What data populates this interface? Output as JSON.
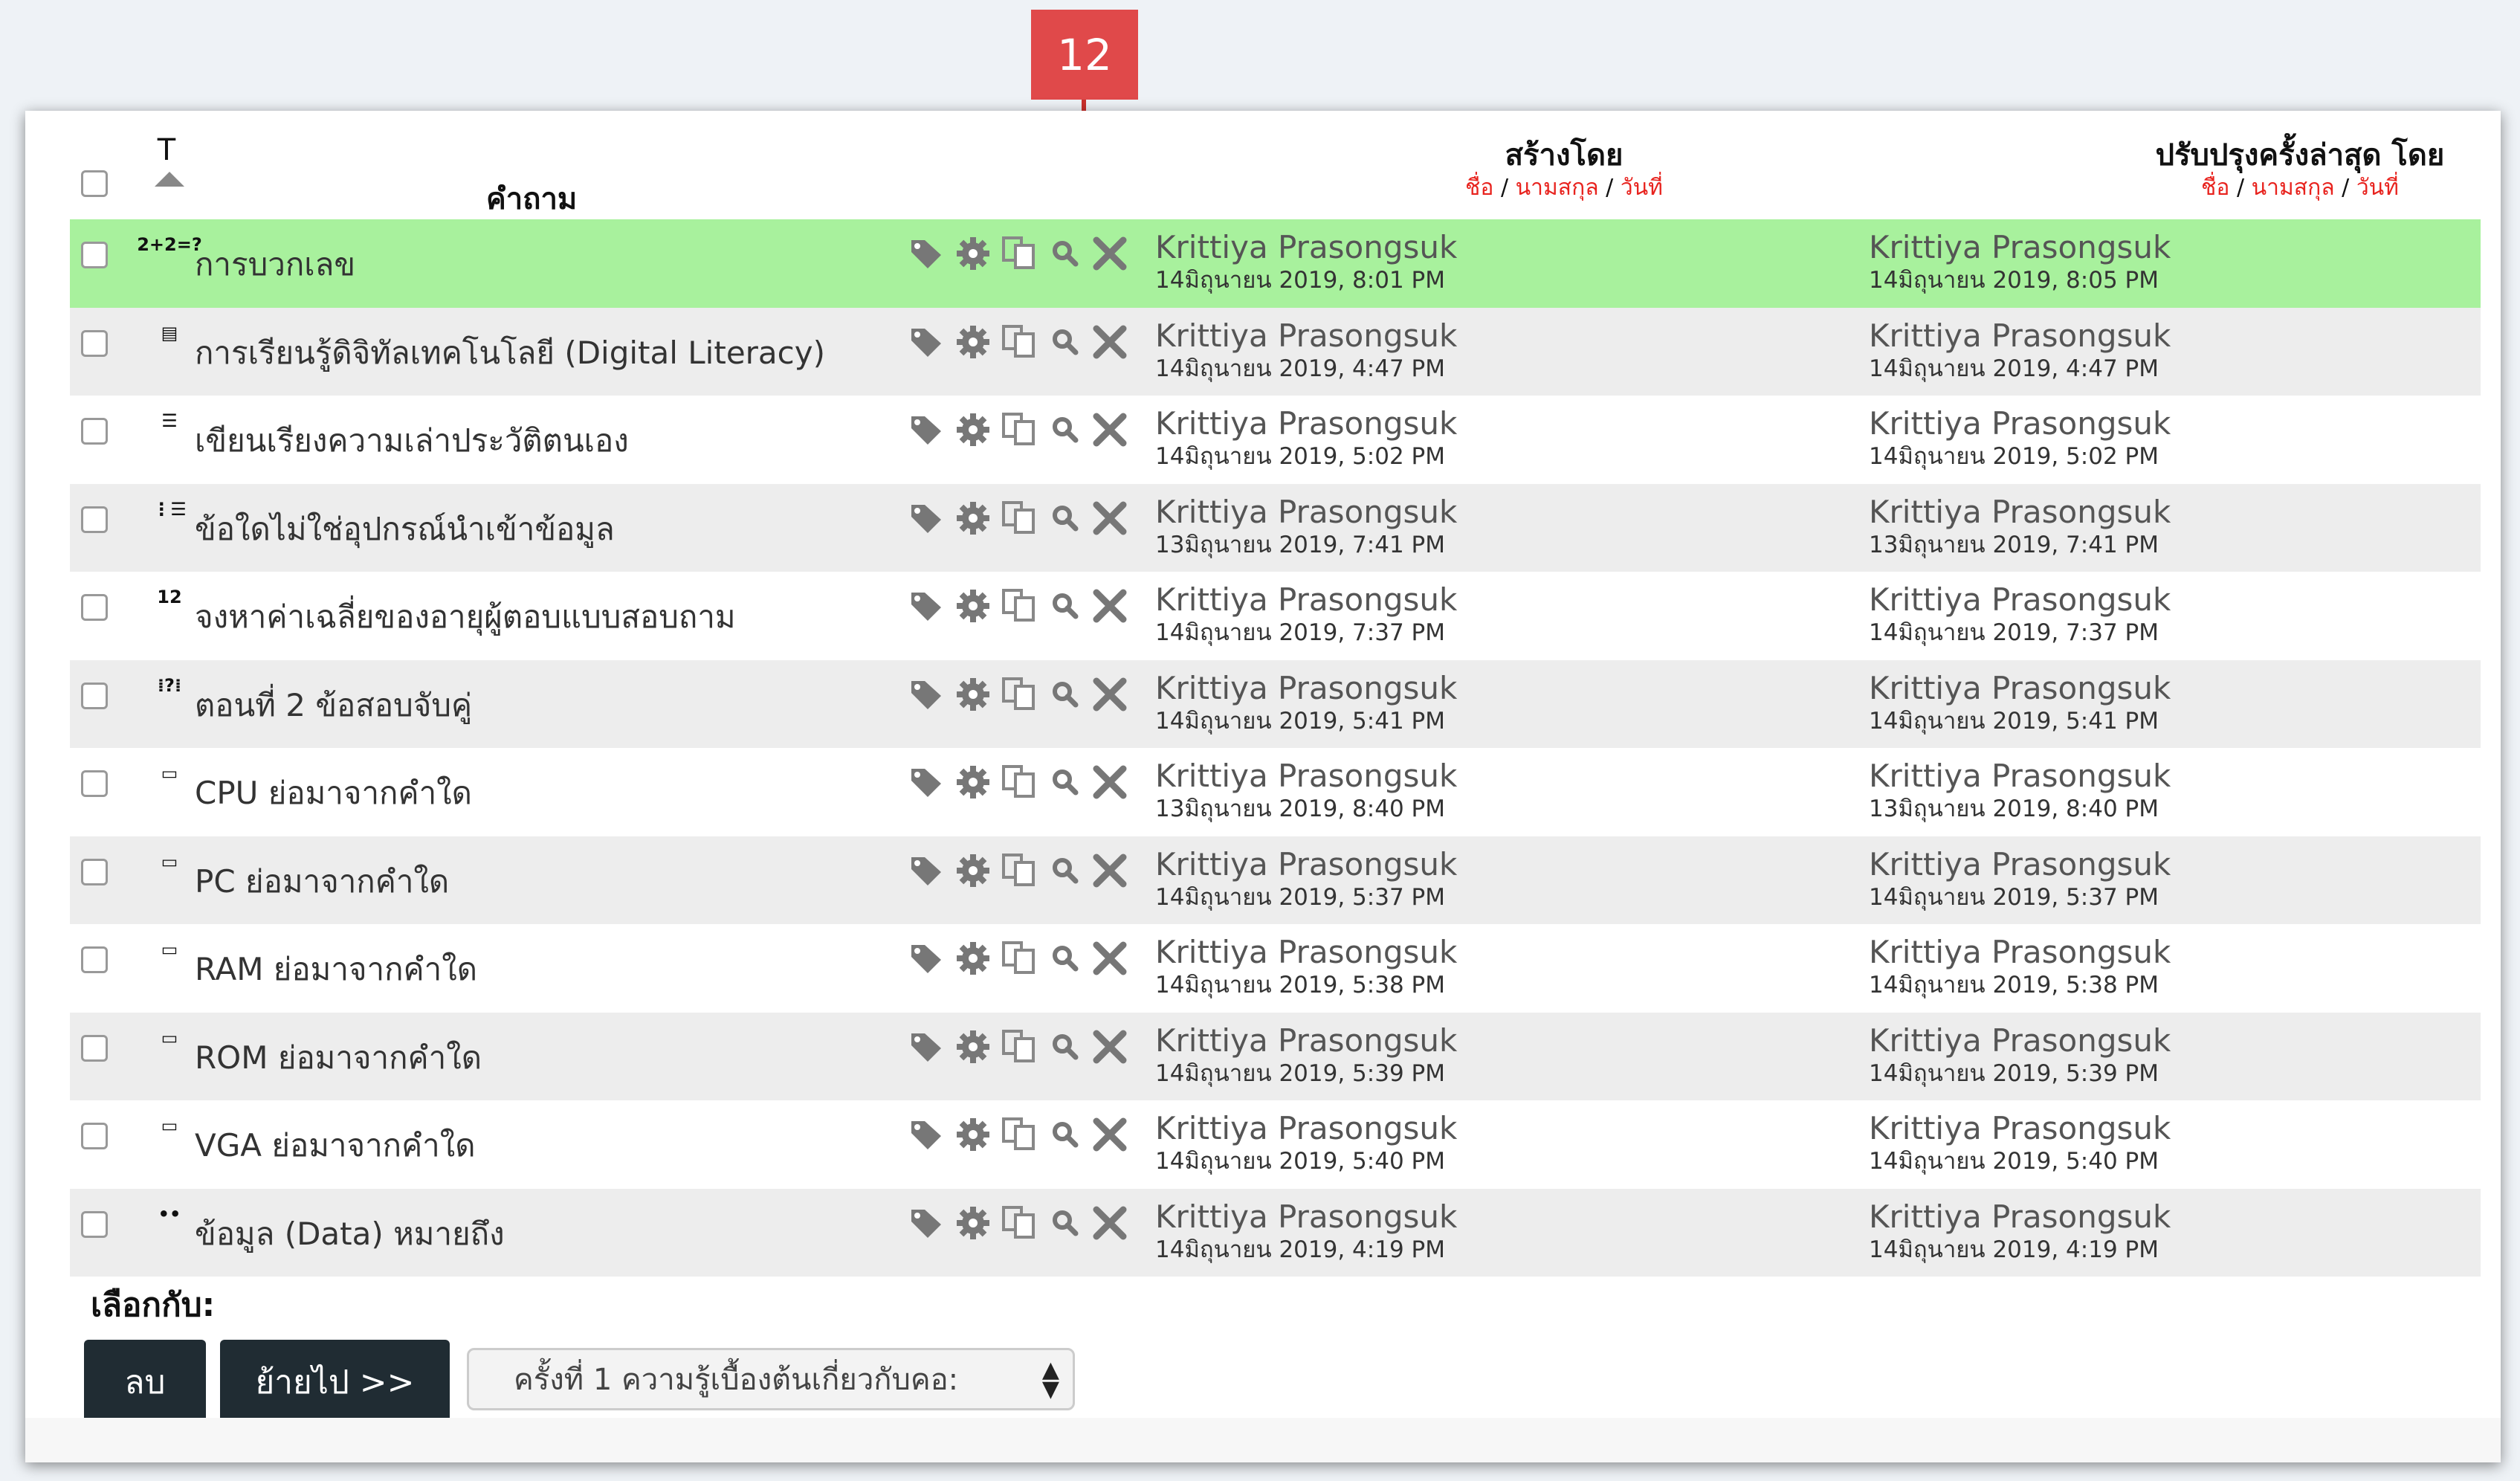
{
  "callout": {
    "number": "12"
  },
  "header": {
    "type_col": "T",
    "question_col": "คำถาม",
    "created_title": "สร้างโดย",
    "modified_title": "ปรับปรุงครั้งล่าสุด โดย",
    "sub_first": "ชื่อ",
    "sub_sep1": " / ",
    "sub_last": "นามสกุล",
    "sub_sep2": " / ",
    "sub_date": "วันที่"
  },
  "rows": [
    {
      "type_icon": "calculated-icon",
      "type_glyph": "2+2=?",
      "name": "การบวกเลข",
      "created_by": "Krittiya Prasongsuk",
      "created_date": "14มิถุนายน 2019, 8:01 PM",
      "modified_by": "Krittiya Prasongsuk",
      "modified_date": "14มิถุนายน 2019, 8:05 PM",
      "highlight": true
    },
    {
      "type_icon": "description-icon",
      "type_glyph": "▤",
      "name": "การเรียนรู้ดิจิทัลเทคโนโลยี (Digital Literacy)",
      "created_by": "Krittiya Prasongsuk",
      "created_date": "14มิถุนายน 2019, 4:47 PM",
      "modified_by": "Krittiya Prasongsuk",
      "modified_date": "14มิถุนายน 2019, 4:47 PM"
    },
    {
      "type_icon": "essay-icon",
      "type_glyph": "☰",
      "name": "เขียนเรียงความเล่าประวัติตนเอง",
      "created_by": "Krittiya Prasongsuk",
      "created_date": "14มิถุนายน 2019, 5:02 PM",
      "modified_by": "Krittiya Prasongsuk",
      "modified_date": "14มิถุนายน 2019, 5:02 PM"
    },
    {
      "type_icon": "multichoice-icon",
      "type_glyph": "⋮☰",
      "name": "ข้อใดไม่ใช่อุปกรณ์นำเข้าข้อมูล",
      "created_by": "Krittiya Prasongsuk",
      "created_date": "13มิถุนายน 2019, 7:41 PM",
      "modified_by": "Krittiya Prasongsuk",
      "modified_date": "13มิถุนายน 2019, 7:41 PM"
    },
    {
      "type_icon": "numerical-icon",
      "type_glyph": "12",
      "name": "จงหาค่าเฉลี่ยของอายุผู้ตอบแบบสอบถาม",
      "created_by": "Krittiya Prasongsuk",
      "created_date": "14มิถุนายน 2019, 7:37 PM",
      "modified_by": "Krittiya Prasongsuk",
      "modified_date": "14มิถุนายน 2019, 7:37 PM"
    },
    {
      "type_icon": "matching-icon",
      "type_glyph": "⁞?⁞",
      "name": "ตอนที่ 2 ข้อสอบจับคู่",
      "created_by": "Krittiya Prasongsuk",
      "created_date": "14มิถุนายน 2019, 5:41 PM",
      "modified_by": "Krittiya Prasongsuk",
      "modified_date": "14มิถุนายน 2019, 5:41 PM"
    },
    {
      "type_icon": "shortanswer-icon",
      "type_glyph": "▭",
      "name": "CPU ย่อมาจากคำใด",
      "created_by": "Krittiya Prasongsuk",
      "created_date": "13มิถุนายน 2019, 8:40 PM",
      "modified_by": "Krittiya Prasongsuk",
      "modified_date": "13มิถุนายน 2019, 8:40 PM"
    },
    {
      "type_icon": "shortanswer-icon",
      "type_glyph": "▭",
      "name": "PC ย่อมาจากคำใด",
      "created_by": "Krittiya Prasongsuk",
      "created_date": "14มิถุนายน 2019, 5:37 PM",
      "modified_by": "Krittiya Prasongsuk",
      "modified_date": "14มิถุนายน 2019, 5:37 PM"
    },
    {
      "type_icon": "shortanswer-icon",
      "type_glyph": "▭",
      "name": "RAM ย่อมาจากคำใด",
      "created_by": "Krittiya Prasongsuk",
      "created_date": "14มิถุนายน 2019, 5:38 PM",
      "modified_by": "Krittiya Prasongsuk",
      "modified_date": "14มิถุนายน 2019, 5:38 PM"
    },
    {
      "type_icon": "shortanswer-icon",
      "type_glyph": "▭",
      "name": "ROM ย่อมาจากคำใด",
      "created_by": "Krittiya Prasongsuk",
      "created_date": "14มิถุนายน 2019, 5:39 PM",
      "modified_by": "Krittiya Prasongsuk",
      "modified_date": "14มิถุนายน 2019, 5:39 PM"
    },
    {
      "type_icon": "shortanswer-icon",
      "type_glyph": "▭",
      "name": "VGA ย่อมาจากคำใด",
      "created_by": "Krittiya Prasongsuk",
      "created_date": "14มิถุนายน 2019, 5:40 PM",
      "modified_by": "Krittiya Prasongsuk",
      "modified_date": "14มิถุนายน 2019, 5:40 PM"
    },
    {
      "type_icon": "truefalse-icon",
      "type_glyph": "••",
      "name": "ข้อมูล (Data) หมายถึง",
      "created_by": "Krittiya Prasongsuk",
      "created_date": "14มิถุนายน 2019, 4:19 PM",
      "modified_by": "Krittiya Prasongsuk",
      "modified_date": "14มิถุนายน 2019, 4:19 PM"
    }
  ],
  "footer": {
    "select_label": "เลือกกับ:",
    "delete_label": "ลบ",
    "move_label": "ย้ายไป >>",
    "category_value": "ครั้งที่ 1 ความรู้เบื้องต้นเกี่ยวกับคอ:"
  },
  "colors": {
    "highlight_row": "#a8f19d",
    "alt_row": "#ededed",
    "button_bg": "#202c33",
    "callout_bg": "#e0494a",
    "link_red": "#e8231e",
    "action_icon": "#777777"
  }
}
